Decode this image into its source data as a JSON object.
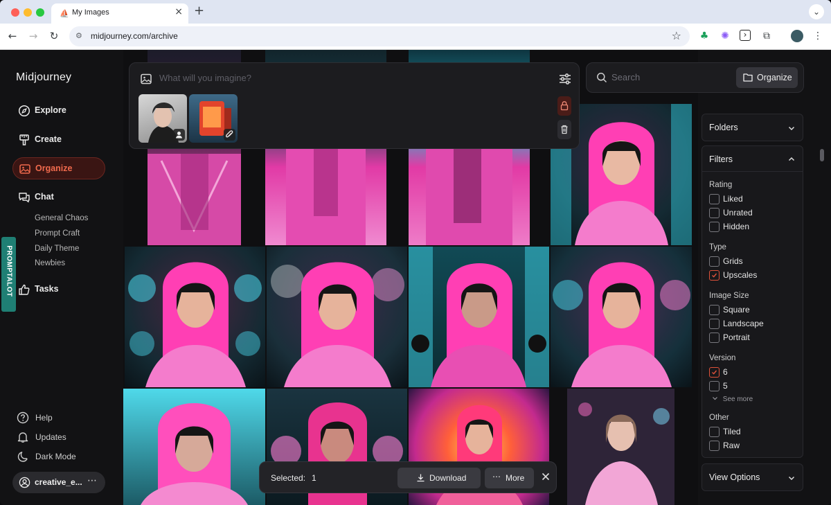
{
  "browser": {
    "tab_title": "My Images",
    "url": "midjourney.com/archive"
  },
  "sidebar": {
    "logo": "Midjourney",
    "nav": [
      {
        "label": "Explore",
        "icon": "compass-icon"
      },
      {
        "label": "Create",
        "icon": "brush-icon"
      },
      {
        "label": "Organize",
        "icon": "image-icon",
        "active": true
      },
      {
        "label": "Chat",
        "icon": "chat-icon"
      },
      {
        "label": "Tasks",
        "icon": "thumbs-up-icon"
      }
    ],
    "chat_rooms": [
      "General Chaos",
      "Prompt Craft",
      "Daily Theme",
      "Newbies"
    ],
    "promptalot_label": "PROMPTALOT",
    "bottom": [
      {
        "label": "Help",
        "icon": "help-icon"
      },
      {
        "label": "Updates",
        "icon": "bell-icon"
      },
      {
        "label": "Dark Mode",
        "icon": "moon-icon"
      }
    ],
    "user": "creative_e..."
  },
  "prompt": {
    "placeholder": "What will you imagine?"
  },
  "search": {
    "placeholder": "Search",
    "organize_label": "Organize"
  },
  "panels": {
    "folders": "Folders",
    "filters": "Filters",
    "view_options": "View Options"
  },
  "filters": {
    "rating_title": "Rating",
    "rating": [
      "Liked",
      "Unrated",
      "Hidden"
    ],
    "type_title": "Type",
    "type": [
      "Grids",
      "Upscales"
    ],
    "size_title": "Image Size",
    "size": [
      "Square",
      "Landscape",
      "Portrait"
    ],
    "version_title": "Version",
    "version": [
      "6",
      "5"
    ],
    "see_more": "See more",
    "other_title": "Other",
    "other": [
      "Tiled",
      "Raw"
    ],
    "checked": [
      "Upscales",
      "6"
    ]
  },
  "selection": {
    "label": "Selected:",
    "count": "1",
    "download_label": "Download",
    "more_label": "More"
  },
  "colors": {
    "accent": "#e0523a",
    "background": "#121214",
    "hoodie_pink": "#ff3fb4",
    "neon_cyan": "#39d8ea"
  }
}
